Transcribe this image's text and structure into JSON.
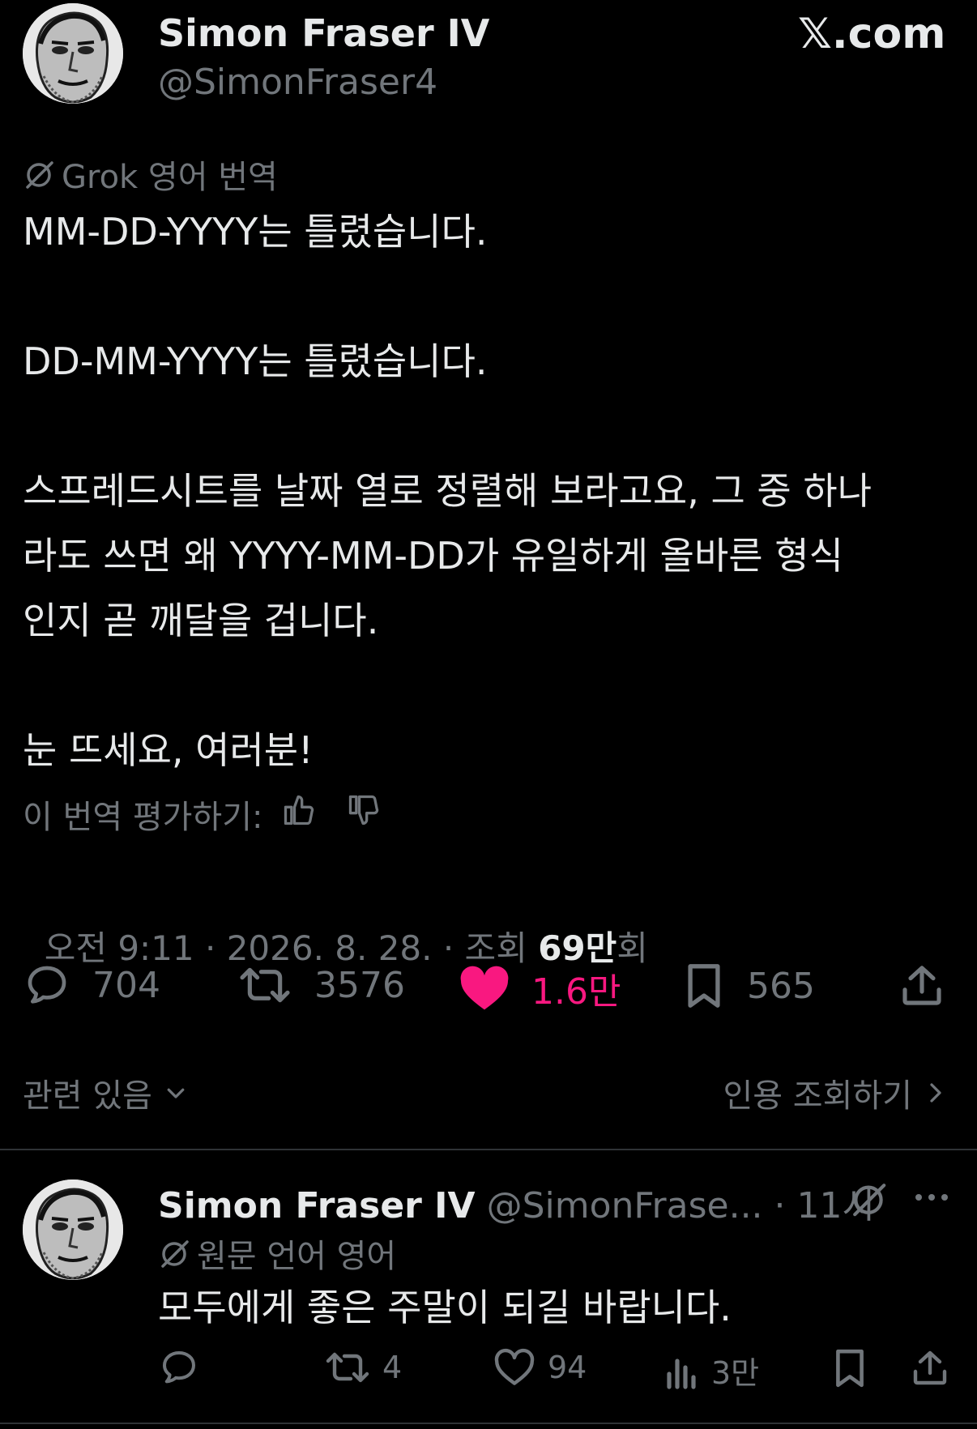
{
  "main_post": {
    "author_name": "Simon Fraser IV",
    "author_handle": "@SimonFraser4",
    "site_brand": "𝕏.com",
    "translation_label": "Grok 영어 번역",
    "paragraphs": [
      "MM-DD-YYYY는 틀렸습니다.",
      "DD-MM-YYYY는 틀렸습니다.",
      "스프레드시트를 날짜 열로 정렬해 보라고요, 그 중 하나\n라도 쓰면 왜 YYYY-MM-DD가 유일하게 올바른 형식\n인지 곧 깨달을 겁니다.",
      "눈 뜨세요, 여러분!"
    ],
    "rate_translation_label": "이 번역 평가하기:",
    "timestamp": "오전 9:11 · 2026. 8. 28. · 조회 ",
    "views_value": "69만",
    "views_suffix": "회",
    "stats": {
      "replies": "704",
      "reposts": "3576",
      "likes": "1.6만",
      "bookmarks": "565"
    },
    "related_label": "관련 있음",
    "quotes_label": "인용 조회하기"
  },
  "reply_post": {
    "author_name": "Simon Fraser IV",
    "author_handle": "@SimonFrase...",
    "time": "· 11시",
    "original_language_label": "원문 언어 영어",
    "text": "모두에게 좋은 주말이 되길 바랍니다.",
    "stats": {
      "replies": "",
      "reposts": "4",
      "likes": "94",
      "views": "3만"
    }
  },
  "colors": {
    "background": "#000000",
    "text": "#e7e9ea",
    "muted": "#71767b",
    "like_active": "#f91880",
    "divider": "#2f3336"
  }
}
